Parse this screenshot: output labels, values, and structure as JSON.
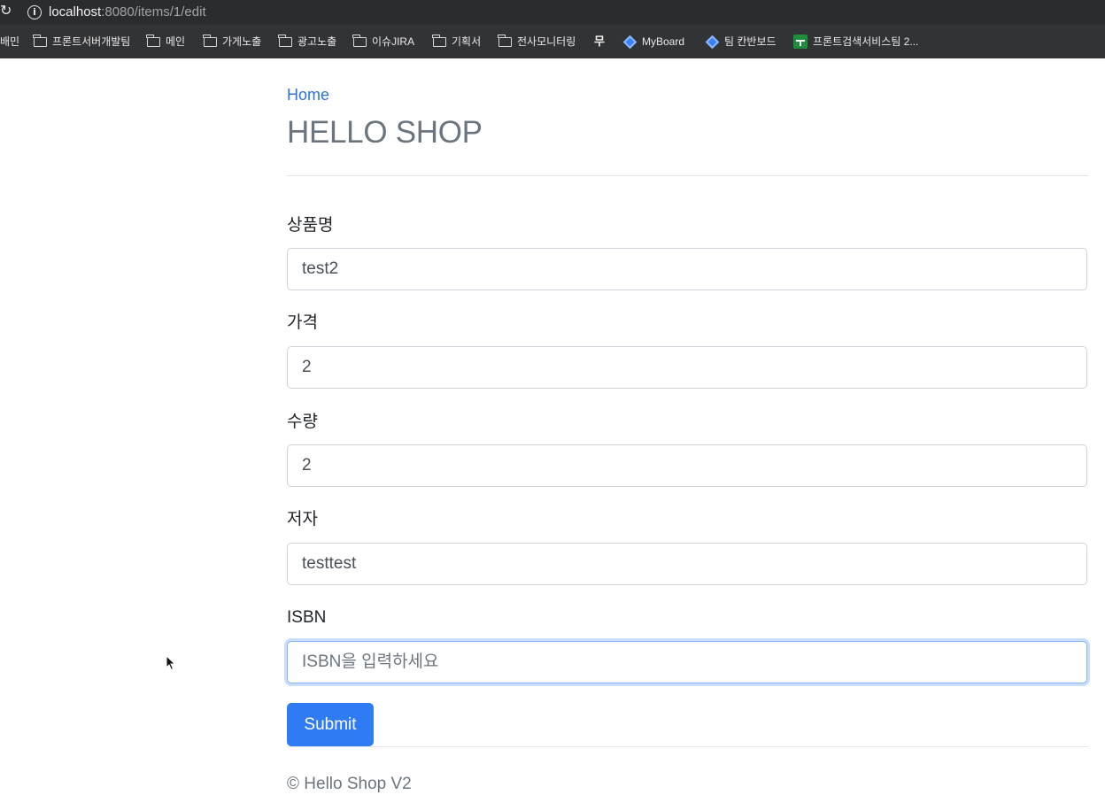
{
  "browser": {
    "reload_glyph": "↻",
    "info_glyph": "i",
    "url_host": "localhost",
    "url_path": ":8080/items/1/edit"
  },
  "bookmarks": [
    {
      "label": "배민",
      "icon": "none"
    },
    {
      "label": "프론트서버개발팀",
      "icon": "folder-icon"
    },
    {
      "label": "메인",
      "icon": "folder-icon"
    },
    {
      "label": "가게노출",
      "icon": "folder-icon"
    },
    {
      "label": "광고노출",
      "icon": "folder-icon"
    },
    {
      "label": "이슈JIRA",
      "icon": "folder-icon"
    },
    {
      "label": "기획서",
      "icon": "folder-icon"
    },
    {
      "label": "전사모니터링",
      "icon": "folder-icon"
    },
    {
      "label": "무",
      "icon": "glyph"
    },
    {
      "label": "MyBoard",
      "icon": "diamond-icon"
    },
    {
      "label": "팀 칸반보드",
      "icon": "diamond-icon"
    },
    {
      "label": "프론트검색서비스팀 2...",
      "icon": "sheet-icon"
    }
  ],
  "page": {
    "home_link": "Home",
    "title": "HELLO SHOP",
    "fields": [
      {
        "label": "상품명",
        "value": "test2",
        "placeholder": ""
      },
      {
        "label": "가격",
        "value": "2",
        "placeholder": ""
      },
      {
        "label": "수량",
        "value": "2",
        "placeholder": ""
      },
      {
        "label": "저자",
        "value": "testtest",
        "placeholder": ""
      },
      {
        "label": "ISBN",
        "value": "",
        "placeholder": "ISBN을 입력하세요"
      }
    ],
    "submit_label": "Submit",
    "footer": "© Hello Shop V2"
  },
  "colors": {
    "link": "#2f73d8",
    "primary_button": "#2f7bf4",
    "title_gray": "#6c757d",
    "focus_ring": "#86b7fe"
  }
}
